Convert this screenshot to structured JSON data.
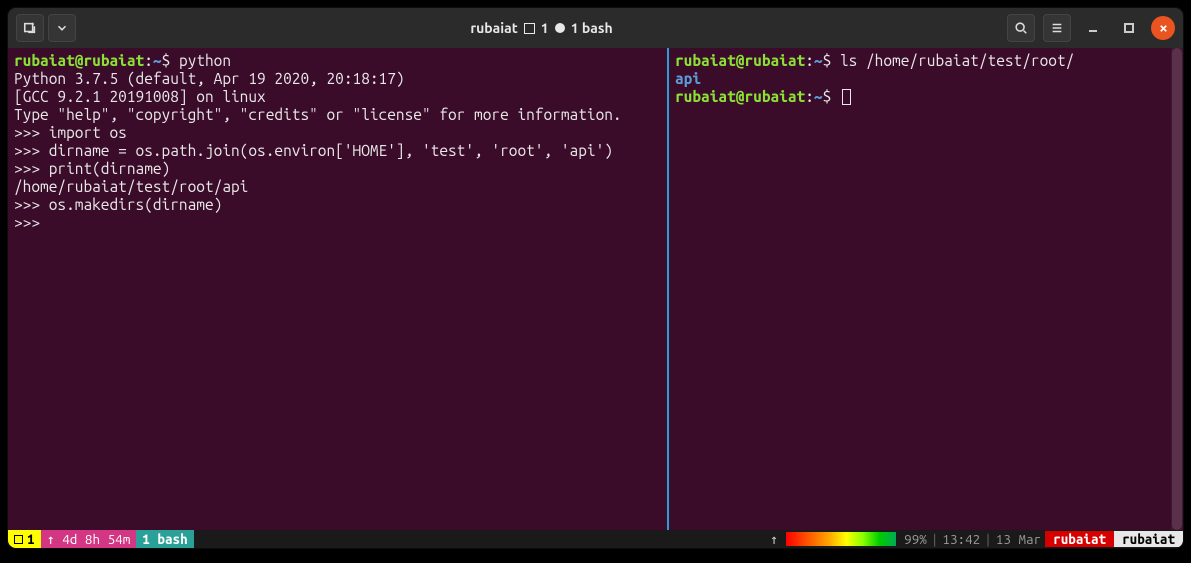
{
  "titlebar": {
    "hostname": "rubaiat",
    "pane_indicator_1": "1",
    "pane_indicator_2": "1 bash"
  },
  "left_pane": {
    "prompt_user": "rubaiat",
    "prompt_at": "@",
    "prompt_host": "rubaiat",
    "prompt_path": "~",
    "prompt_sep": ":",
    "prompt_sym": "$",
    "commands": {
      "cmd1": " python",
      "py_line1": "Python 3.7.5 (default, Apr 19 2020, 20:18:17)",
      "py_line2": "[GCC 9.2.1 20191008] on linux",
      "py_line3": "Type \"help\", \"copyright\", \"credits\" or \"license\" for more information.",
      "repl1": ">>> import os",
      "repl2": ">>> dirname = os.path.join(os.environ['HOME'], 'test', 'root', 'api')",
      "repl3": ">>> print(dirname)",
      "out1": "/home/rubaiat/test/root/api",
      "repl4": ">>> os.makedirs(dirname)",
      "repl5": ">>> "
    }
  },
  "right_pane": {
    "prompt_user": "rubaiat",
    "prompt_at": "@",
    "prompt_host": "rubaiat",
    "prompt_path": "~",
    "prompt_sep": ":",
    "prompt_sym": "$",
    "cmd1": " ls /home/rubaiat/test/root/",
    "out1": "api"
  },
  "statusbar": {
    "session_num": "1",
    "uptime": "↑ 4d 8h 54m",
    "window": "1 bash",
    "battery_pct": "99%",
    "time": "13:42",
    "date": "13 Mar",
    "name1": "rubaiat",
    "name2": "rubaiat"
  }
}
